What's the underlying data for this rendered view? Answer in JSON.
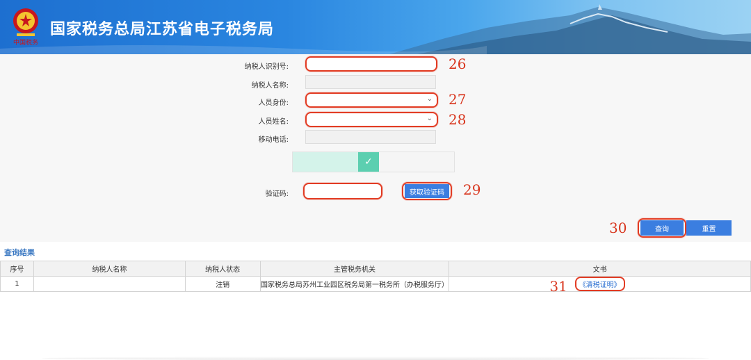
{
  "header": {
    "title": "国家税务总局江苏省电子税务局",
    "emblem_caption": "中国税务"
  },
  "form": {
    "taxpayer_id": {
      "label": "纳税人识别号:",
      "value": "",
      "placeholder": ""
    },
    "taxpayer_name": {
      "label": "纳税人名称:",
      "value": ""
    },
    "role": {
      "label": "人员身份:",
      "selected": ""
    },
    "person_name": {
      "label": "人员姓名:",
      "selected": ""
    },
    "mobile": {
      "label": "移动电话:",
      "value": ""
    },
    "captcha": {
      "label": "验证码:",
      "value": ""
    },
    "get_code_button": "获取验证码",
    "slider_check_icon": "checkmark-icon"
  },
  "actions": {
    "query_button": "查询",
    "reset_button": "重置"
  },
  "annotations": [
    "26",
    "27",
    "28",
    "29",
    "30",
    "31"
  ],
  "results": {
    "title": "查询结果",
    "columns": [
      "序号",
      "纳税人名称",
      "纳税人状态",
      "主管税务机关",
      "文书"
    ],
    "rows": [
      {
        "index": "1",
        "name": "",
        "status": "注销",
        "authority": "国家税务总局苏州工业园区税务局第一税务所（办税服务厅）",
        "document": "《清税证明》"
      }
    ]
  },
  "colors": {
    "accent": "#3b7ee0",
    "highlight": "#e23c24",
    "slider": "#5ccfb0",
    "link": "#2a6ed1"
  }
}
